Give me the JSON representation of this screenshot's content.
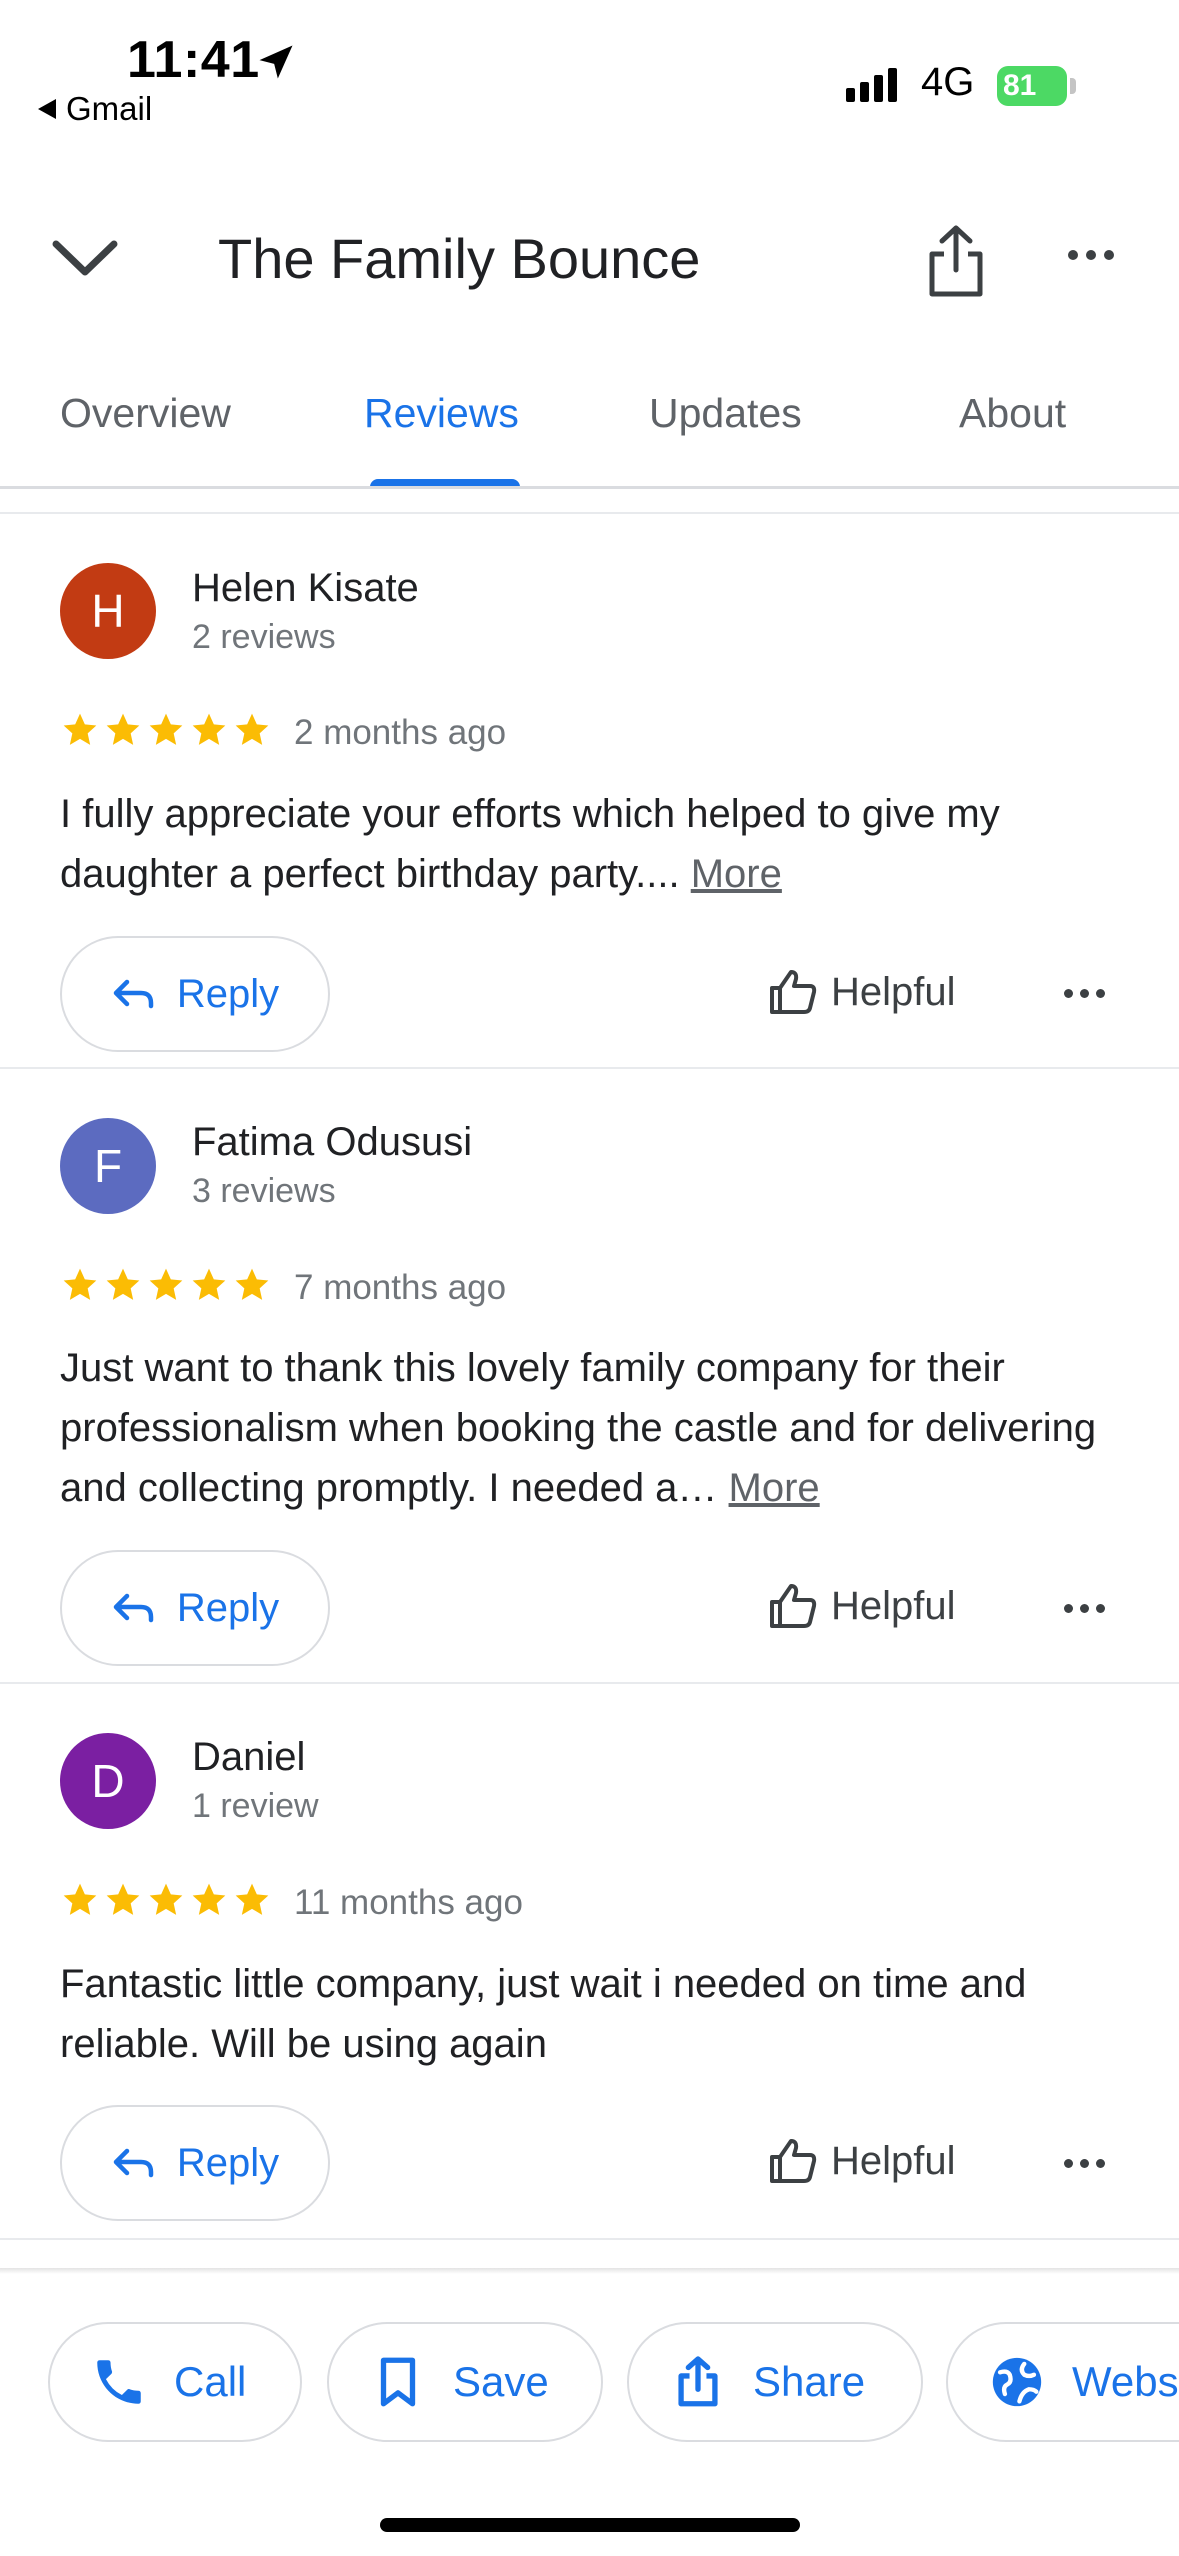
{
  "status_bar": {
    "time": "11:41",
    "back_app": "Gmail",
    "network": "4G",
    "battery": "81"
  },
  "header": {
    "title": "The Family Bounce"
  },
  "tabs": [
    {
      "label": "Overview",
      "active": false
    },
    {
      "label": "Reviews",
      "active": true
    },
    {
      "label": "Updates",
      "active": false
    },
    {
      "label": "About",
      "active": false
    }
  ],
  "reviews": [
    {
      "initial": "H",
      "avatar_color": "#c23b13",
      "author": "Helen Kisate",
      "count": "2 reviews",
      "rating": 5,
      "time": "2 months ago",
      "text": "I fully appreciate your efforts which helped to give my daughter a perfect birthday party.... ",
      "more": "More"
    },
    {
      "initial": "F",
      "avatar_color": "#5c6bc0",
      "author": "Fatima Odususi",
      "count": "3 reviews",
      "rating": 5,
      "time": "7 months ago",
      "text": "Just want to thank this lovely family company for their professionalism when booking the castle and for delivering and collecting promptly. I needed a… ",
      "more": "More"
    },
    {
      "initial": "D",
      "avatar_color": "#7b1fa2",
      "author": "Daniel",
      "count": "1 review",
      "rating": 5,
      "time": "11 months ago",
      "text": "Fantastic little company, just wait i needed on time and reliable. Will be using again",
      "more": ""
    }
  ],
  "review_actions": {
    "reply": "Reply",
    "helpful": "Helpful"
  },
  "bottom_actions": {
    "call": "Call",
    "save": "Save",
    "share": "Share",
    "website": "Website"
  },
  "colors": {
    "accent": "#1a73e8",
    "star": "#fbbc04"
  }
}
